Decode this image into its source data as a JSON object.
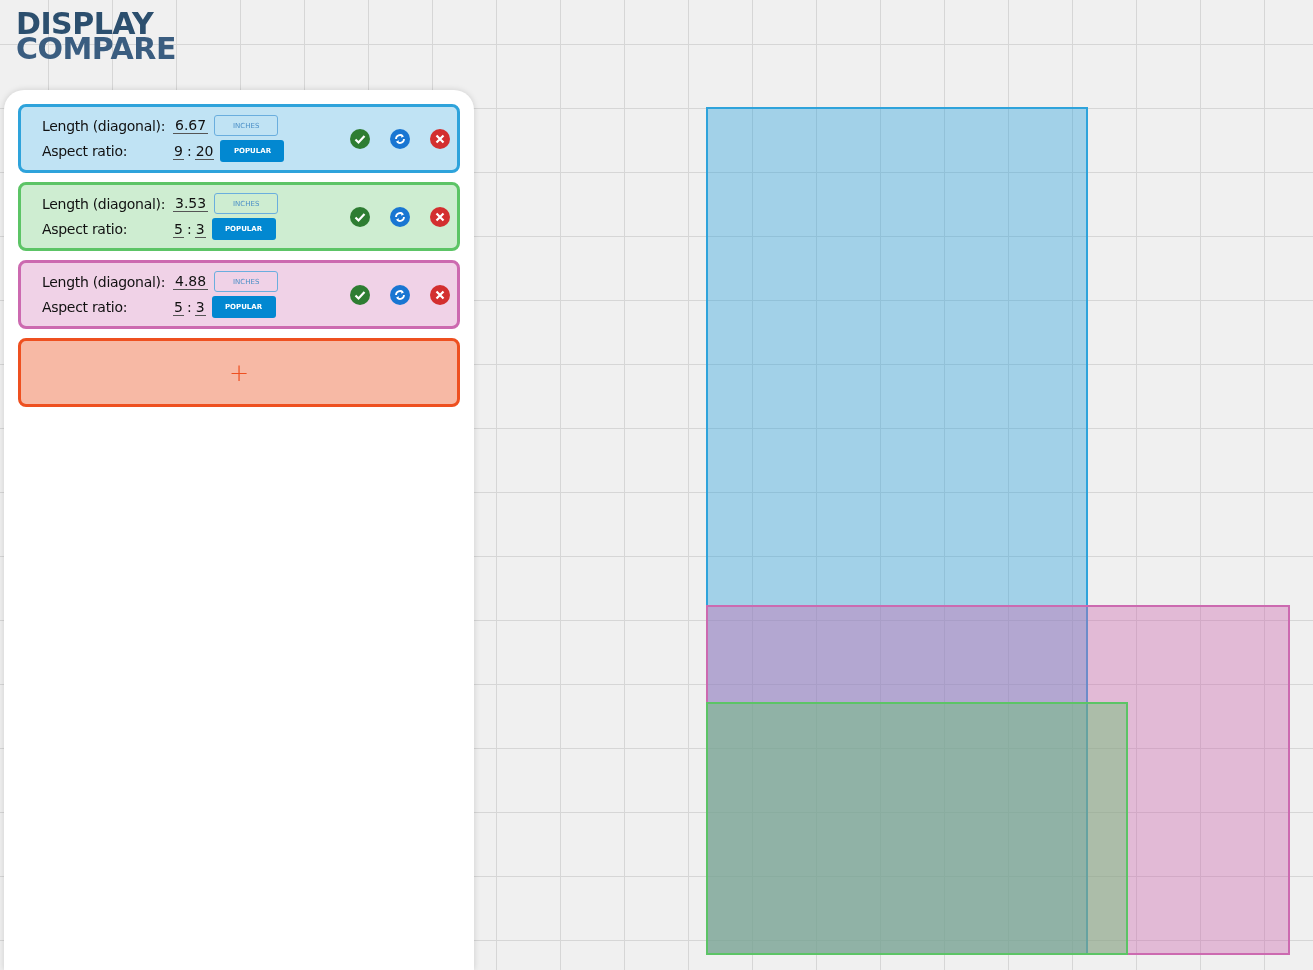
{
  "logo": {
    "line_1": "DISPLAY",
    "line_2": "COMPARE"
  },
  "displays": [
    {
      "length_label": "Length (diagonal):",
      "length": "6.67",
      "unit": "INCHES",
      "aspect_label": "Aspect ratio:",
      "ratio_w": "9",
      "ratio_sep": ":",
      "ratio_h": "20",
      "preset_button": "POPULAR",
      "color": "#2ea3db"
    },
    {
      "length_label": "Length (diagonal):",
      "length": "3.53",
      "unit": "INCHES",
      "aspect_label": "Aspect ratio:",
      "ratio_w": "5",
      "ratio_sep": ":",
      "ratio_h": "3",
      "preset_button": "POPULAR",
      "color": "#5cc466"
    },
    {
      "length_label": "Length (diagonal):",
      "length": "4.88",
      "unit": "INCHES",
      "aspect_label": "Aspect ratio:",
      "ratio_w": "5",
      "ratio_sep": ":",
      "ratio_h": "3",
      "preset_button": "POPULAR",
      "color": "#cc6ab0"
    }
  ],
  "add_button": {
    "label": "+"
  }
}
